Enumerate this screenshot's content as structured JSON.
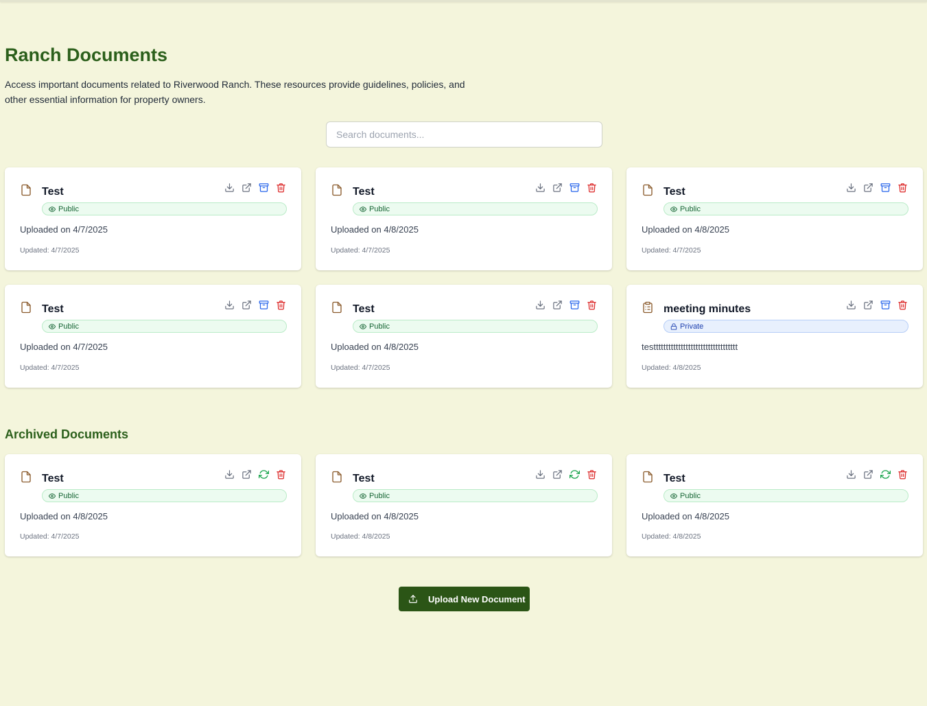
{
  "page": {
    "title": "Ranch Documents",
    "description": "Access important documents related to Riverwood Ranch. These resources provide guidelines, policies, and other essential information for property owners."
  },
  "search": {
    "placeholder": "Search documents...",
    "value": ""
  },
  "colors": {
    "brand_green": "#2b5f1b",
    "background": "#f4f5dc",
    "public_badge": "#ecfbf0",
    "private_badge": "#e8f0fd",
    "delete_red": "#dc2626",
    "archive_blue": "#2563eb",
    "restore_green": "#16a34a"
  },
  "documents": [
    {
      "title": "Test",
      "icon": "file-icon",
      "visibility": "Public",
      "line": "Uploaded on 4/7/2025",
      "updated": "Updated: 4/7/2025"
    },
    {
      "title": "Test",
      "icon": "file-icon",
      "visibility": "Public",
      "line": "Uploaded on 4/8/2025",
      "updated": "Updated: 4/7/2025"
    },
    {
      "title": "Test",
      "icon": "file-icon",
      "visibility": "Public",
      "line": "Uploaded on 4/8/2025",
      "updated": "Updated: 4/7/2025"
    },
    {
      "title": "Test",
      "icon": "file-icon",
      "visibility": "Public",
      "line": "Uploaded on 4/7/2025",
      "updated": "Updated: 4/7/2025"
    },
    {
      "title": "Test",
      "icon": "file-icon",
      "visibility": "Public",
      "line": "Uploaded on 4/8/2025",
      "updated": "Updated: 4/7/2025"
    },
    {
      "title": "meeting minutes",
      "icon": "clipboard-icon",
      "visibility": "Private",
      "line": "testttttttttttttttttttttttttttttttttt",
      "updated": "Updated: 4/8/2025"
    }
  ],
  "archived": {
    "title": "Archived Documents",
    "documents": [
      {
        "title": "Test",
        "icon": "file-icon",
        "visibility": "Public",
        "line": "Uploaded on 4/8/2025",
        "updated": "Updated: 4/7/2025"
      },
      {
        "title": "Test",
        "icon": "file-icon",
        "visibility": "Public",
        "line": "Uploaded on 4/8/2025",
        "updated": "Updated: 4/8/2025"
      },
      {
        "title": "Test",
        "icon": "file-icon",
        "visibility": "Public",
        "line": "Uploaded on 4/8/2025",
        "updated": "Updated: 4/8/2025"
      }
    ]
  },
  "upload_button": {
    "label": "Upload New Document",
    "icon": "upload-icon"
  }
}
